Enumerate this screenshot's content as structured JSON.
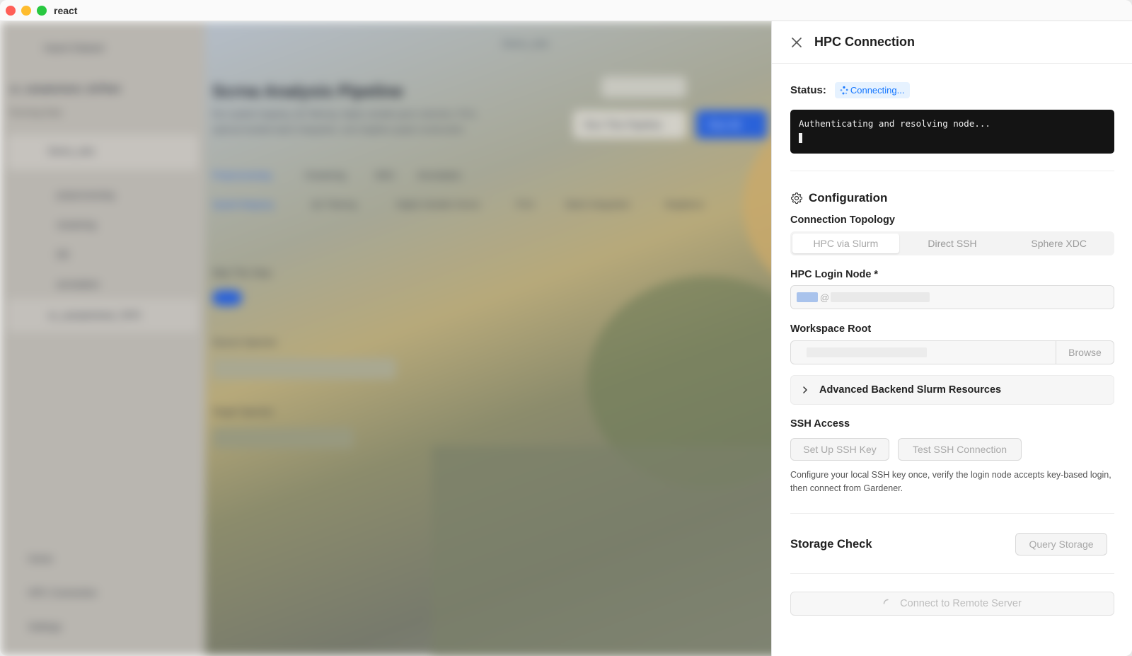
{
  "window": {
    "title": "react"
  },
  "background": {
    "sidebar_project": "Import Dataset",
    "sidebar_dataset": "sc_samplesheet_AAT9ed",
    "sidebar_dataset_sub": "Running Data",
    "sidebar_items": [
      "Demo_sets",
      "preprocessing",
      "clustering",
      "DE",
      "annotation",
      "sc_samplesheet_TAT5"
    ],
    "sidebar_bottom": [
      "Home",
      "HPC Connection",
      "Settings"
    ],
    "breadcrumb": "Demo_sets",
    "page_title": "Scrna Analysis Pipeline",
    "page_desc_1": "Run spatial mapping, QC filtering, highly variable gene selection, PCA,",
    "page_desc_2": "optional doublet batch integration, and neighbor graph construction",
    "run_step_btn": "Run This Pipeline",
    "run_all_btn": "Run All",
    "tabs": [
      "Preprocessing",
      "Clustering",
      "DEG",
      "Annotation"
    ],
    "subtabs": [
      "Spatial Mapping",
      "QC Filtering",
      "Highly Variable Genes",
      "PCA",
      "Batch Integration",
      "Neighbors"
    ],
    "toggle_label": "Skip This Step",
    "source_label": "Source Species",
    "target_label": "Target Species"
  },
  "panel": {
    "title": "HPC Connection",
    "status_label": "Status:",
    "status_value": "Connecting...",
    "terminal_line": "Authenticating and resolving node...",
    "configuration_title": "Configuration",
    "topology_label": "Connection Topology",
    "topology_options": [
      "HPC via Slurm",
      "Direct SSH",
      "Sphere XDC"
    ],
    "topology_selected": "HPC via Slurm",
    "login_node_label": "HPC Login Node *",
    "login_node_at": "@",
    "workspace_label": "Workspace Root",
    "browse_label": "Browse",
    "advanced_label": "Advanced Backend Slurm Resources",
    "ssh_access_label": "SSH Access",
    "setup_ssh_label": "Set Up SSH Key",
    "test_ssh_label": "Test SSH Connection",
    "ssh_help": "Configure your local SSH key once, verify the login node accepts key-based login, then connect from Gardener.",
    "storage_title": "Storage Check",
    "query_storage_label": "Query Storage",
    "connect_label": "Connect to Remote Server"
  },
  "colors": {
    "accent": "#1677ff",
    "terminal_bg": "#141414"
  }
}
